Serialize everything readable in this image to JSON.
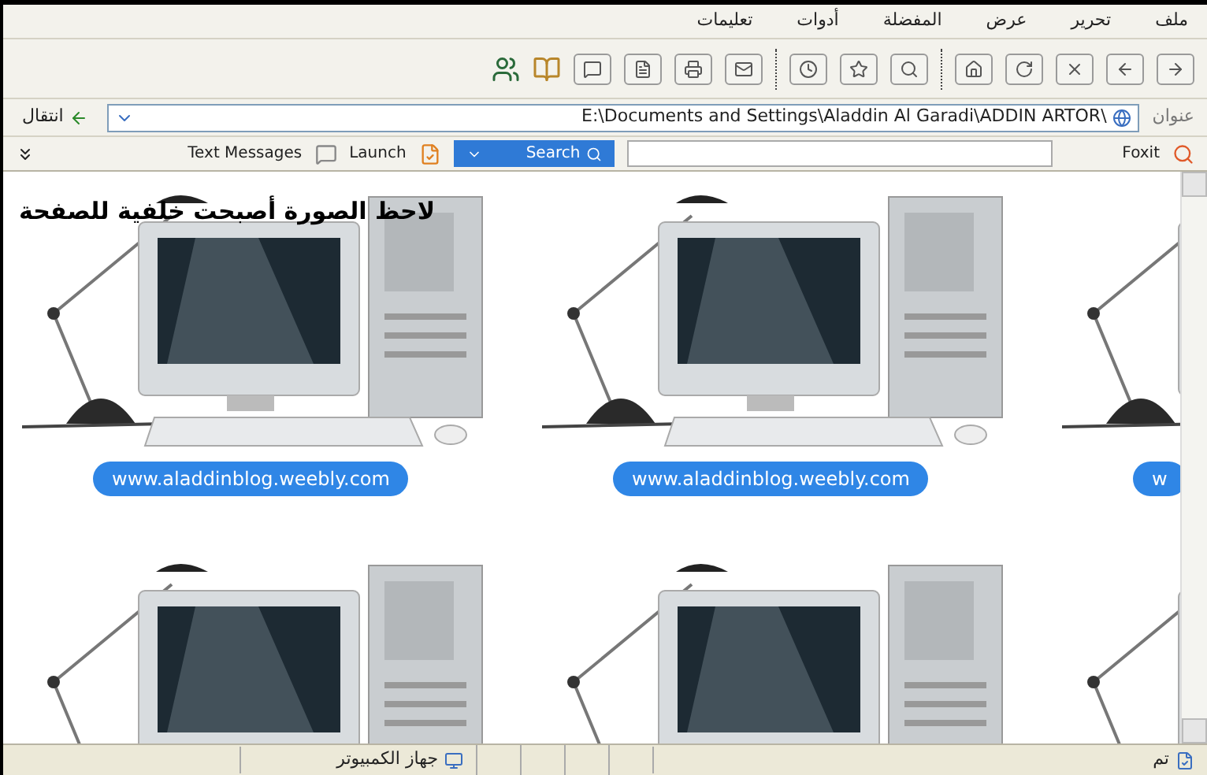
{
  "menu": [
    {
      "label": "ملف"
    },
    {
      "label": "تحرير"
    },
    {
      "label": "عرض"
    },
    {
      "label": "المفضلة"
    },
    {
      "label": "أدوات"
    },
    {
      "label": "تعليمات"
    }
  ],
  "address_bar": {
    "label": "عنوان",
    "value": "E:\\Documents and Settings\\Aladdin Al Garadi\\ADDIN ARTOR\\",
    "go_button": "انتقال"
  },
  "links_bar": {
    "foxit": "Foxit",
    "search_button": "Search",
    "launch": "Launch",
    "text_messages": "Text Messages"
  },
  "page": {
    "heading": "لاحظ الصورة أصبحت خلفية للصفحة",
    "tiles": [
      {
        "caption": "w"
      },
      {
        "caption": "www.aladdinblog.weebly.com"
      },
      {
        "caption": "www.aladdinblog.weebly.com"
      }
    ]
  },
  "status_bar": {
    "status": "تم",
    "zone": "جهاز الكمبيوتر"
  }
}
